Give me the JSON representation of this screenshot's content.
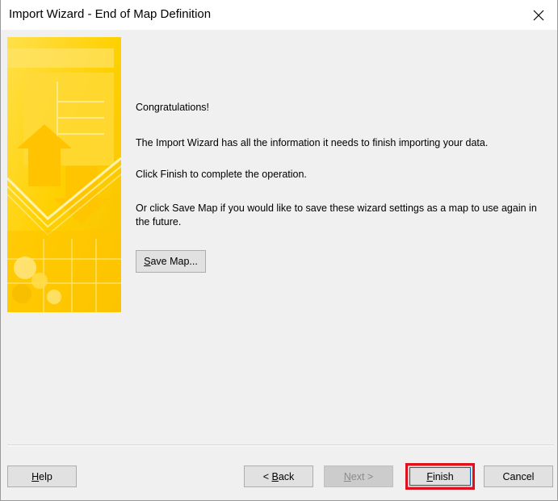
{
  "window": {
    "title": "Import Wizard - End of Map Definition"
  },
  "content": {
    "congrats": "Congratulations!",
    "info": "The Import Wizard has all the information it needs to finish importing your data.",
    "instruction": "Click Finish to complete the operation.",
    "save_hint": "Or click Save Map if you would like to save these wizard settings as a map to use again in the future."
  },
  "buttons": {
    "save_map": {
      "mnemonic": "S",
      "rest": "ave Map..."
    },
    "help": {
      "mnemonic": "H",
      "rest": "elp"
    },
    "back": {
      "prefix": "< ",
      "mnemonic": "B",
      "rest": "ack"
    },
    "next": {
      "mnemonic": "N",
      "rest": "ext >",
      "enabled": false
    },
    "finish": {
      "mnemonic": "F",
      "rest": "inish",
      "highlighted": true
    },
    "cancel": {
      "label": "Cancel"
    }
  },
  "colors": {
    "highlight": "#e0101e",
    "banner_primary": "#ffd400",
    "banner_accent": "#ffe877"
  },
  "icons": {
    "close": "close-icon",
    "banner": "import-banner-graphic"
  }
}
